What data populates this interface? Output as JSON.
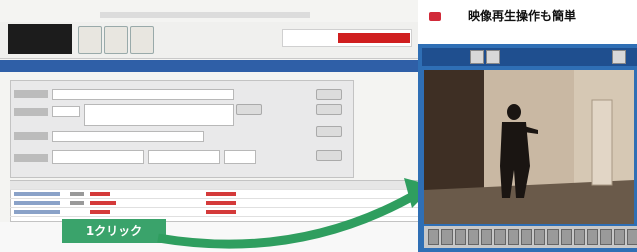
{
  "caption": {
    "text": "映像再生操作も簡単"
  },
  "callout": {
    "text": "1クリック"
  },
  "colors": {
    "accent_green": "#3aa36b",
    "title_blue": "#2f5fa7",
    "player_blue": "#2f6fb5",
    "alert_red": "#d12a39"
  },
  "icons": {
    "bullet": "red-square-bullet",
    "arrow": "green-curved-arrow"
  }
}
